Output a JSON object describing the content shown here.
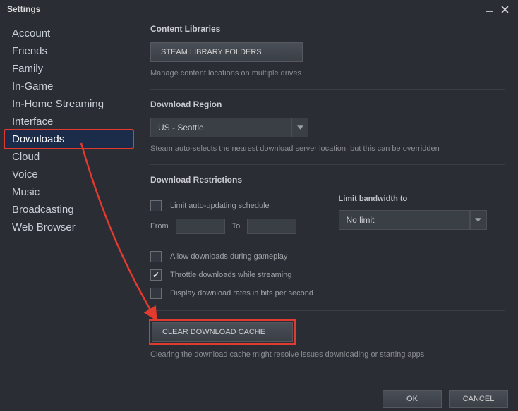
{
  "titlebar": {
    "title": "Settings"
  },
  "sidebar": {
    "items": [
      {
        "label": "Account"
      },
      {
        "label": "Friends"
      },
      {
        "label": "Family"
      },
      {
        "label": "In-Game"
      },
      {
        "label": "In-Home Streaming"
      },
      {
        "label": "Interface"
      },
      {
        "label": "Downloads",
        "selected": true
      },
      {
        "label": "Cloud"
      },
      {
        "label": "Voice"
      },
      {
        "label": "Music"
      },
      {
        "label": "Broadcasting"
      },
      {
        "label": "Web Browser"
      }
    ]
  },
  "main": {
    "content_libraries_title": "Content Libraries",
    "library_folders_btn": "STEAM LIBRARY FOLDERS",
    "library_help": "Manage content locations on multiple drives",
    "download_region_title": "Download Region",
    "region_value": "US - Seattle",
    "region_help": "Steam auto-selects the nearest download server location, but this can be overridden",
    "restrictions_title": "Download Restrictions",
    "limit_schedule_label": "Limit auto-updating schedule",
    "from_label": "From",
    "to_label": "To",
    "limit_bandwidth_title": "Limit bandwidth to",
    "bandwidth_value": "No limit",
    "allow_gameplay_label": "Allow downloads during gameplay",
    "throttle_label": "Throttle downloads while streaming",
    "display_bits_label": "Display download rates in bits per second",
    "clear_cache_btn": "CLEAR DOWNLOAD CACHE",
    "clear_cache_help": "Clearing the download cache might resolve issues downloading or starting apps"
  },
  "footer": {
    "ok": "OK",
    "cancel": "CANCEL"
  }
}
